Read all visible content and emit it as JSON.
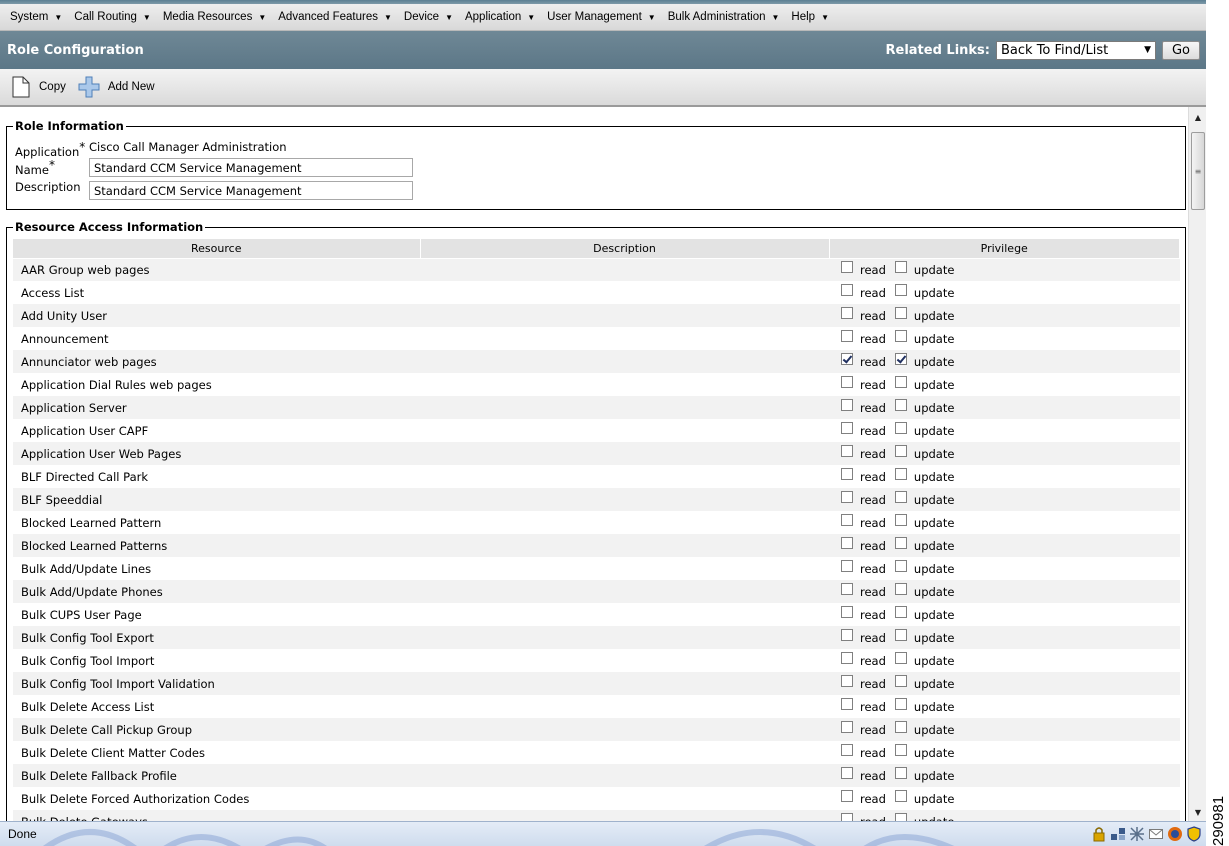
{
  "menubar": {
    "items": [
      {
        "label": "System"
      },
      {
        "label": "Call Routing"
      },
      {
        "label": "Media Resources"
      },
      {
        "label": "Advanced Features"
      },
      {
        "label": "Device"
      },
      {
        "label": "Application"
      },
      {
        "label": "User Management"
      },
      {
        "label": "Bulk Administration"
      },
      {
        "label": "Help"
      }
    ]
  },
  "titlebar": {
    "title": "Role Configuration",
    "related_links_label": "Related Links:",
    "related_links_value": "Back To Find/List",
    "go_label": "Go"
  },
  "toolbar": {
    "copy_label": "Copy",
    "add_new_label": "Add New"
  },
  "role_info": {
    "legend": "Role Information",
    "application_label": "Application",
    "application_value": "Cisco Call Manager Administration",
    "name_label": "Name",
    "name_value": "Standard CCM Service Management",
    "description_label": "Description",
    "description_value": "Standard CCM Service Management",
    "required_mark": "*"
  },
  "resource_access": {
    "legend": "Resource Access Information",
    "columns": [
      "Resource",
      "Description",
      "Privilege"
    ],
    "read_label": "read",
    "update_label": "update",
    "rows": [
      {
        "resource": "AAR Group web pages",
        "description": "",
        "read": false,
        "update": false
      },
      {
        "resource": "Access List",
        "description": "",
        "read": false,
        "update": false
      },
      {
        "resource": "Add Unity User",
        "description": "",
        "read": false,
        "update": false
      },
      {
        "resource": "Announcement",
        "description": "",
        "read": false,
        "update": false
      },
      {
        "resource": "Annunciator web pages",
        "description": "",
        "read": true,
        "update": true
      },
      {
        "resource": "Application Dial Rules web pages",
        "description": "",
        "read": false,
        "update": false
      },
      {
        "resource": "Application Server",
        "description": "",
        "read": false,
        "update": false
      },
      {
        "resource": "Application User CAPF",
        "description": "",
        "read": false,
        "update": false
      },
      {
        "resource": "Application User Web Pages",
        "description": "",
        "read": false,
        "update": false
      },
      {
        "resource": "BLF Directed Call Park",
        "description": "",
        "read": false,
        "update": false
      },
      {
        "resource": "BLF Speeddial",
        "description": "",
        "read": false,
        "update": false
      },
      {
        "resource": "Blocked Learned Pattern",
        "description": "",
        "read": false,
        "update": false
      },
      {
        "resource": "Blocked Learned Patterns",
        "description": "",
        "read": false,
        "update": false
      },
      {
        "resource": "Bulk Add/Update Lines",
        "description": "",
        "read": false,
        "update": false
      },
      {
        "resource": "Bulk Add/Update Phones",
        "description": "",
        "read": false,
        "update": false
      },
      {
        "resource": "Bulk CUPS User Page",
        "description": "",
        "read": false,
        "update": false
      },
      {
        "resource": "Bulk Config Tool Export",
        "description": "",
        "read": false,
        "update": false
      },
      {
        "resource": "Bulk Config Tool Import",
        "description": "",
        "read": false,
        "update": false
      },
      {
        "resource": "Bulk Config Tool Import Validation",
        "description": "",
        "read": false,
        "update": false
      },
      {
        "resource": "Bulk Delete Access List",
        "description": "",
        "read": false,
        "update": false
      },
      {
        "resource": "Bulk Delete Call Pickup Group",
        "description": "",
        "read": false,
        "update": false
      },
      {
        "resource": "Bulk Delete Client Matter Codes",
        "description": "",
        "read": false,
        "update": false
      },
      {
        "resource": "Bulk Delete Fallback Profile",
        "description": "",
        "read": false,
        "update": false
      },
      {
        "resource": "Bulk Delete Forced Authorization Codes",
        "description": "",
        "read": false,
        "update": false
      },
      {
        "resource": "Bulk Delete Gateways",
        "description": "",
        "read": false,
        "update": false
      }
    ]
  },
  "statusbar": {
    "status_text": "Done"
  },
  "figure_id": "290981"
}
